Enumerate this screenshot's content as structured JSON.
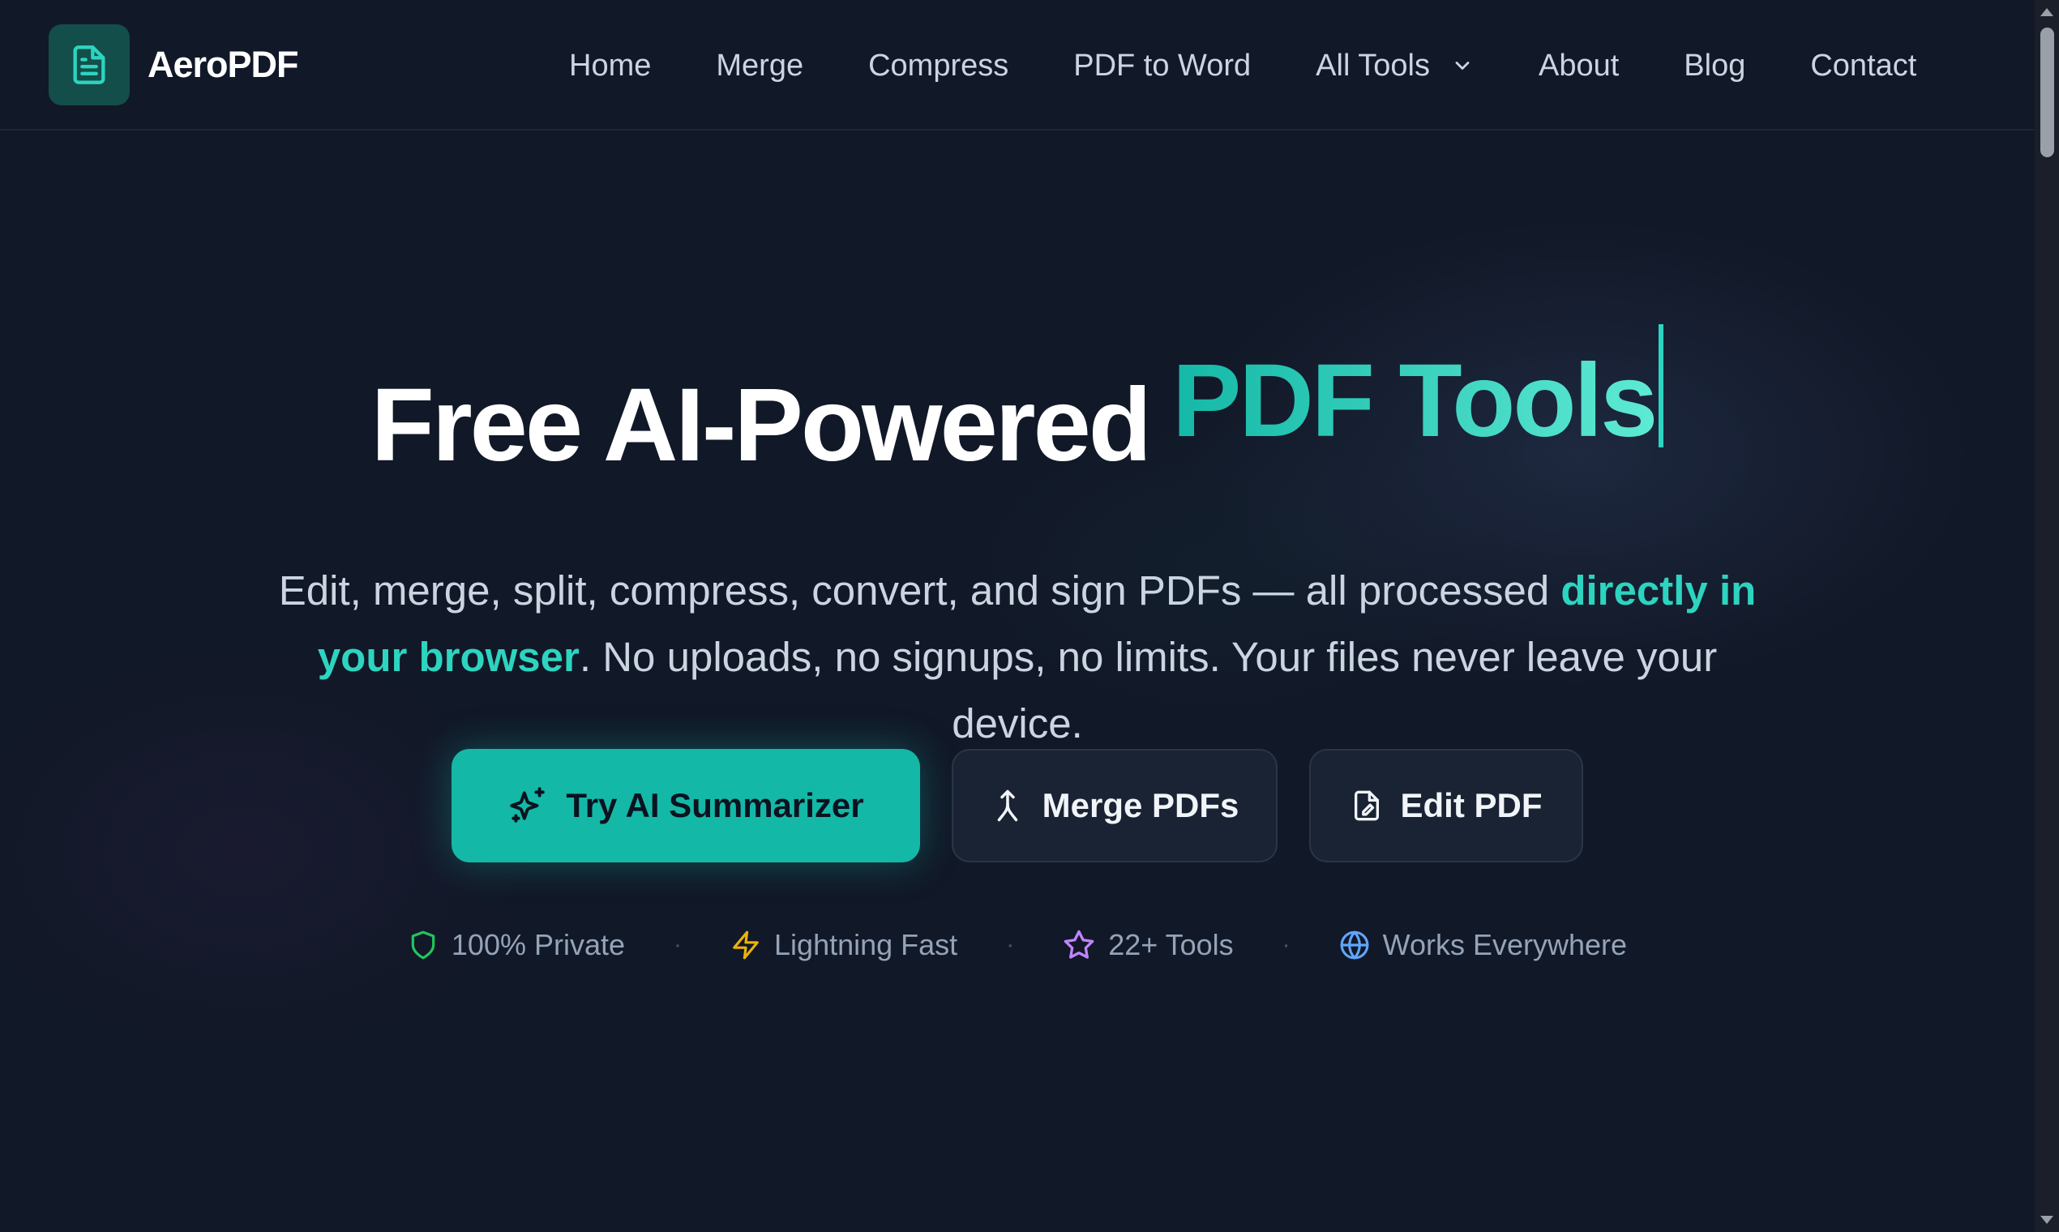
{
  "header": {
    "brand": "AeroPDF",
    "logo_icon": "file-text-icon",
    "nav": [
      {
        "label": "Home"
      },
      {
        "label": "Merge"
      },
      {
        "label": "Compress"
      },
      {
        "label": "PDF to Word"
      },
      {
        "label": "All Tools",
        "icon": "chevron-down-icon"
      },
      {
        "label": "About"
      },
      {
        "label": "Blog"
      },
      {
        "label": "Contact"
      }
    ]
  },
  "hero": {
    "title_main": "Free AI-Powered",
    "title_accent": "PDF Tools",
    "subtitle_before": "Edit, merge, split, compress, convert, and sign PDFs — all processed ",
    "subtitle_highlight": "directly in your browser",
    "subtitle_after": ". No uploads, no signups, no limits. Your files never leave your device."
  },
  "actions": {
    "primary": {
      "label": "Try AI Summarizer",
      "icon": "sparkles-icon"
    },
    "merge": {
      "label": "Merge PDFs",
      "icon": "merge-icon"
    },
    "edit": {
      "label": "Edit PDF",
      "icon": "file-edit-icon"
    }
  },
  "features": [
    {
      "label": "100% Private",
      "icon": "shield-icon",
      "color": "#22c55e"
    },
    {
      "label": "Lightning Fast",
      "icon": "lightning-icon",
      "color": "#eab308"
    },
    {
      "label": "22+ Tools",
      "icon": "star-icon",
      "color": "#c084fc"
    },
    {
      "label": "Works Everywhere",
      "icon": "globe-icon",
      "color": "#60a5fa"
    }
  ],
  "separator": "·",
  "colors": {
    "background": "#111827",
    "accent": "#14b8a6",
    "accent_light": "#2dd4bf",
    "text": "#cbd5e1",
    "muted": "#94a3b8"
  }
}
